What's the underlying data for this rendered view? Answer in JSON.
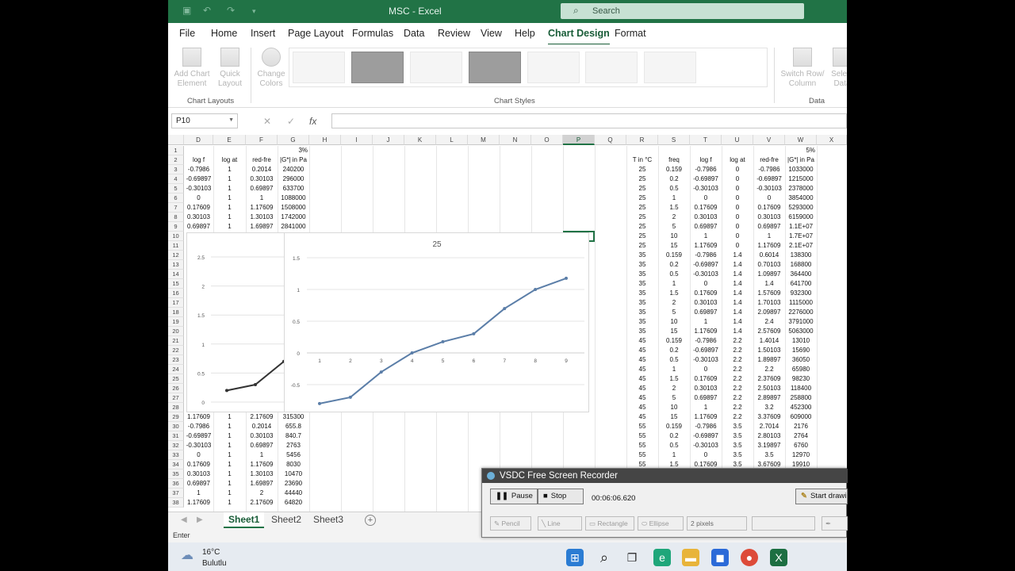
{
  "window": {
    "title": "MSC - Excel",
    "search_placeholder": "Search"
  },
  "menu": [
    "File",
    "Home",
    "Insert",
    "Page Layout",
    "Formulas",
    "Data",
    "Review",
    "View",
    "Help",
    "Chart Design",
    "Format"
  ],
  "active_menu": "Chart Design",
  "ribbon": {
    "add_chart_element": "Add Chart Element",
    "quick_layout": "Quick Layout",
    "change_colors": "Change Colors",
    "switch_row_column": "Switch Row/ Column",
    "select_data": "Select Data",
    "group_chart_layouts": "Chart Layouts",
    "group_chart_styles": "Chart Styles",
    "group_data": "Data"
  },
  "formula_bar": {
    "name_box": "P10",
    "fx": "fx",
    "cancel": "✕",
    "enter": "✓",
    "value": ""
  },
  "columns_left": [
    "D",
    "E",
    "F",
    "G",
    "H",
    "I",
    "J",
    "K",
    "L",
    "M",
    "N",
    "O",
    "P",
    "Q"
  ],
  "columns_right": [
    "R",
    "S",
    "T",
    "U",
    "V",
    "W",
    "X"
  ],
  "selected_column": "P",
  "rows": [
    "1",
    "2",
    "3",
    "4",
    "5",
    "6",
    "7",
    "8",
    "9",
    "10",
    "11",
    "12",
    "13",
    "14",
    "15",
    "16",
    "17",
    "18",
    "19",
    "20",
    "21",
    "22",
    "23",
    "24",
    "25",
    "26",
    "27",
    "28",
    "29",
    "30",
    "31",
    "32",
    "33",
    "34",
    "35",
    "36",
    "37",
    "38"
  ],
  "left_table": {
    "note": "3%",
    "headers": [
      "log f",
      "log at",
      "red-fre",
      "|G*| in Pa"
    ],
    "top_rows": [
      [
        "-0.7986",
        "1",
        "0.2014",
        "240200"
      ],
      [
        "-0.69897",
        "1",
        "0.30103",
        "296000"
      ],
      [
        "-0.30103",
        "1",
        "0.69897",
        "633700"
      ],
      [
        "0",
        "1",
        "1",
        "1088000"
      ],
      [
        "0.17609",
        "1",
        "1.17609",
        "1508000"
      ],
      [
        "0.30103",
        "1",
        "1.30103",
        "1742000"
      ],
      [
        "0.69897",
        "1",
        "1.69897",
        "2841000"
      ]
    ],
    "bottom_rows": [
      [
        "1.17609",
        "1",
        "2.17609",
        "315300"
      ],
      [
        "-0.7986",
        "1",
        "0.2014",
        "655.8"
      ],
      [
        "-0.69897",
        "1",
        "0.30103",
        "840.7"
      ],
      [
        "-0.30103",
        "1",
        "0.69897",
        "2763"
      ],
      [
        "0",
        "1",
        "1",
        "5456"
      ],
      [
        "0.17609",
        "1",
        "1.17609",
        "8030"
      ],
      [
        "0.30103",
        "1",
        "1.30103",
        "10470"
      ],
      [
        "0.69897",
        "1",
        "1.69897",
        "23690"
      ],
      [
        "1",
        "1",
        "2",
        "44440"
      ],
      [
        "1.17609",
        "1",
        "2.17609",
        "64820"
      ]
    ]
  },
  "right_table": {
    "note": "5%",
    "headers": [
      "T in °C",
      "freq",
      "log f",
      "log at",
      "red-fre",
      "|G*| in Pa"
    ],
    "rows": [
      [
        "25",
        "0.159",
        "-0.7986",
        "0",
        "-0.7986",
        "1033000"
      ],
      [
        "25",
        "0.2",
        "-0.69897",
        "0",
        "-0.69897",
        "1215000"
      ],
      [
        "25",
        "0.5",
        "-0.30103",
        "0",
        "-0.30103",
        "2378000"
      ],
      [
        "25",
        "1",
        "0",
        "0",
        "0",
        "3854000"
      ],
      [
        "25",
        "1.5",
        "0.17609",
        "0",
        "0.17609",
        "5293000"
      ],
      [
        "25",
        "2",
        "0.30103",
        "0",
        "0.30103",
        "6159000"
      ],
      [
        "25",
        "5",
        "0.69897",
        "0",
        "0.69897",
        "1.1E+07"
      ],
      [
        "25",
        "10",
        "1",
        "0",
        "1",
        "1.7E+07"
      ],
      [
        "25",
        "15",
        "1.17609",
        "0",
        "1.17609",
        "2.1E+07"
      ],
      [
        "35",
        "0.159",
        "-0.7986",
        "1.4",
        "0.6014",
        "138300"
      ],
      [
        "35",
        "0.2",
        "-0.69897",
        "1.4",
        "0.70103",
        "168800"
      ],
      [
        "35",
        "0.5",
        "-0.30103",
        "1.4",
        "1.09897",
        "364400"
      ],
      [
        "35",
        "1",
        "0",
        "1.4",
        "1.4",
        "641700"
      ],
      [
        "35",
        "1.5",
        "0.17609",
        "1.4",
        "1.57609",
        "932300"
      ],
      [
        "35",
        "2",
        "0.30103",
        "1.4",
        "1.70103",
        "1115000"
      ],
      [
        "35",
        "5",
        "0.69897",
        "1.4",
        "2.09897",
        "2276000"
      ],
      [
        "35",
        "10",
        "1",
        "1.4",
        "2.4",
        "3791000"
      ],
      [
        "35",
        "15",
        "1.17609",
        "1.4",
        "2.57609",
        "5063000"
      ],
      [
        "45",
        "0.159",
        "-0.7986",
        "2.2",
        "1.4014",
        "13010"
      ],
      [
        "45",
        "0.2",
        "-0.69897",
        "2.2",
        "1.50103",
        "15690"
      ],
      [
        "45",
        "0.5",
        "-0.30103",
        "2.2",
        "1.89897",
        "36050"
      ],
      [
        "45",
        "1",
        "0",
        "2.2",
        "2.2",
        "65980"
      ],
      [
        "45",
        "1.5",
        "0.17609",
        "2.2",
        "2.37609",
        "98230"
      ],
      [
        "45",
        "2",
        "0.30103",
        "2.2",
        "2.50103",
        "118400"
      ],
      [
        "45",
        "5",
        "0.69897",
        "2.2",
        "2.89897",
        "258800"
      ],
      [
        "45",
        "10",
        "1",
        "2.2",
        "3.2",
        "452300"
      ],
      [
        "45",
        "15",
        "1.17609",
        "2.2",
        "3.37609",
        "609000"
      ],
      [
        "55",
        "0.159",
        "-0.7986",
        "3.5",
        "2.7014",
        "2176"
      ],
      [
        "55",
        "0.2",
        "-0.69897",
        "3.5",
        "2.80103",
        "2764"
      ],
      [
        "55",
        "0.5",
        "-0.30103",
        "3.5",
        "3.19897",
        "6760"
      ],
      [
        "55",
        "1",
        "0",
        "3.5",
        "3.5",
        "12970"
      ],
      [
        "55",
        "1.5",
        "0.17609",
        "3.5",
        "3.67609",
        "19910"
      ]
    ]
  },
  "chart_data": [
    {
      "type": "line",
      "title": "25",
      "categories": [
        "1",
        "2",
        "3",
        "4",
        "5",
        "6",
        "7",
        "8",
        "9"
      ],
      "values": [
        -0.7986,
        -0.69897,
        -0.30103,
        0,
        0.17609,
        0.30103,
        0.69897,
        1,
        1.17609
      ],
      "ylim": [
        -1,
        1.5
      ],
      "yticks": [
        "1.5",
        "1",
        "0.5",
        "0",
        "-0.5",
        "-1"
      ],
      "grid": true,
      "color": "#5b7ea8"
    },
    {
      "type": "line",
      "title": "",
      "values": [
        0.2,
        0.3,
        0.7
      ],
      "ylim": [
        0,
        2.5
      ],
      "yticks": [
        "2.5",
        "2",
        "1.5",
        "1",
        "0.5",
        "0"
      ],
      "grid": true,
      "color": "#333333"
    }
  ],
  "sheets": [
    "Sheet1",
    "Sheet2",
    "Sheet3"
  ],
  "active_sheet": "Sheet1",
  "status": "Enter",
  "weather": {
    "temp": "16°C",
    "condition": "Bulutlu"
  },
  "recorder": {
    "title": "VSDC Free Screen Recorder",
    "pause": "Pause",
    "stop": "Stop",
    "time": "00:06:06.620",
    "start_drawing": "Start drawi",
    "pencil": "Pencil",
    "line": "Line",
    "rectangle": "Rectangle",
    "ellipse": "Ellipse",
    "pixels": "2 pixels"
  }
}
